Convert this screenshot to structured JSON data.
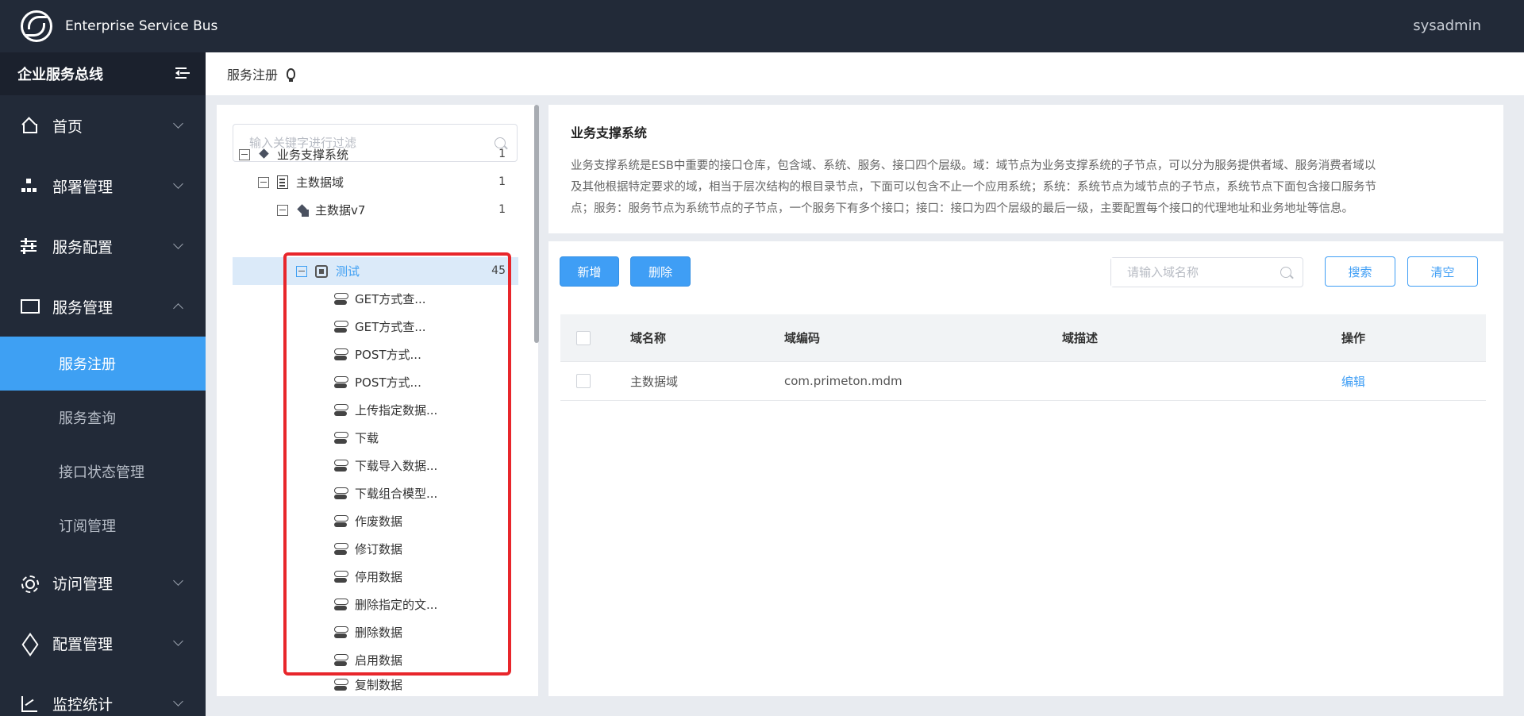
{
  "header": {
    "app_title": "Enterprise Service Bus",
    "user": "sysadmin"
  },
  "sidebar": {
    "title": "企业服务总线",
    "menu": [
      {
        "label": "首页",
        "icon": "home-icon"
      },
      {
        "label": "部署管理",
        "icon": "org-icon"
      },
      {
        "label": "服务配置",
        "icon": "sliders-icon"
      },
      {
        "label": "服务管理",
        "icon": "monitor-icon"
      }
    ],
    "submenu": [
      {
        "label": "服务注册",
        "active": true
      },
      {
        "label": "服务查询"
      },
      {
        "label": "接口状态管理"
      },
      {
        "label": "订阅管理"
      }
    ],
    "menu_bottom": [
      {
        "label": "访问管理",
        "icon": "gear-icon"
      },
      {
        "label": "配置管理",
        "icon": "box-icon"
      },
      {
        "label": "监控统计",
        "icon": "chart-icon"
      }
    ]
  },
  "breadcrumb": {
    "title": "服务注册"
  },
  "tree": {
    "filter_placeholder": "输入关键字进行过滤",
    "root": {
      "label": "业务支撑系统",
      "count": "1"
    },
    "domain": {
      "label": "主数据域",
      "count": "1"
    },
    "system": {
      "label": "主数据v7",
      "count": "1"
    },
    "service": {
      "label": "测试",
      "count": "45"
    },
    "interfaces": [
      "GET方式查...",
      "GET方式查...",
      "POST方式...",
      "POST方式...",
      "上传指定数据...",
      "下载",
      "下载导入数据...",
      "下载组合模型...",
      "作废数据",
      "修订数据",
      "停用数据",
      "删除指定的文...",
      "删除数据",
      "启用数据",
      "复制数据"
    ]
  },
  "description": {
    "title": "业务支撑系统",
    "line1": "业务支撑系统是ESB中重要的接口仓库，包含域、系统、服务、接口四个层级。域：域节点为业务支撑系统的子节点，可以分为服务提供者域、服务消费者域以",
    "line2": "及其他根据特定要求的域，相当于层次结构的根目录节点，下面可以包含不止一个应用系统；系统：系统节点为域节点的子节点，系统节点下面包含接口服务节",
    "line3": "点；服务：服务节点为系统节点的子节点，一个服务下有多个接口；接口：接口为四个层级的最后一级，主要配置每个接口的代理地址和业务地址等信息。"
  },
  "toolbar": {
    "add_label": "新增",
    "delete_label": "删除",
    "search_placeholder": "请输入域名称",
    "search_label": "搜索",
    "clear_label": "清空"
  },
  "table": {
    "headers": {
      "name": "域名称",
      "code": "域编码",
      "desc": "域描述",
      "ops": "操作"
    },
    "rows": [
      {
        "name": "主数据域",
        "code": "com.primeton.mdm",
        "desc": "",
        "op": "编辑"
      }
    ]
  },
  "colors": {
    "accent": "#3f9ef5",
    "header_bg": "#222a38",
    "highlight": "#e8262b"
  }
}
